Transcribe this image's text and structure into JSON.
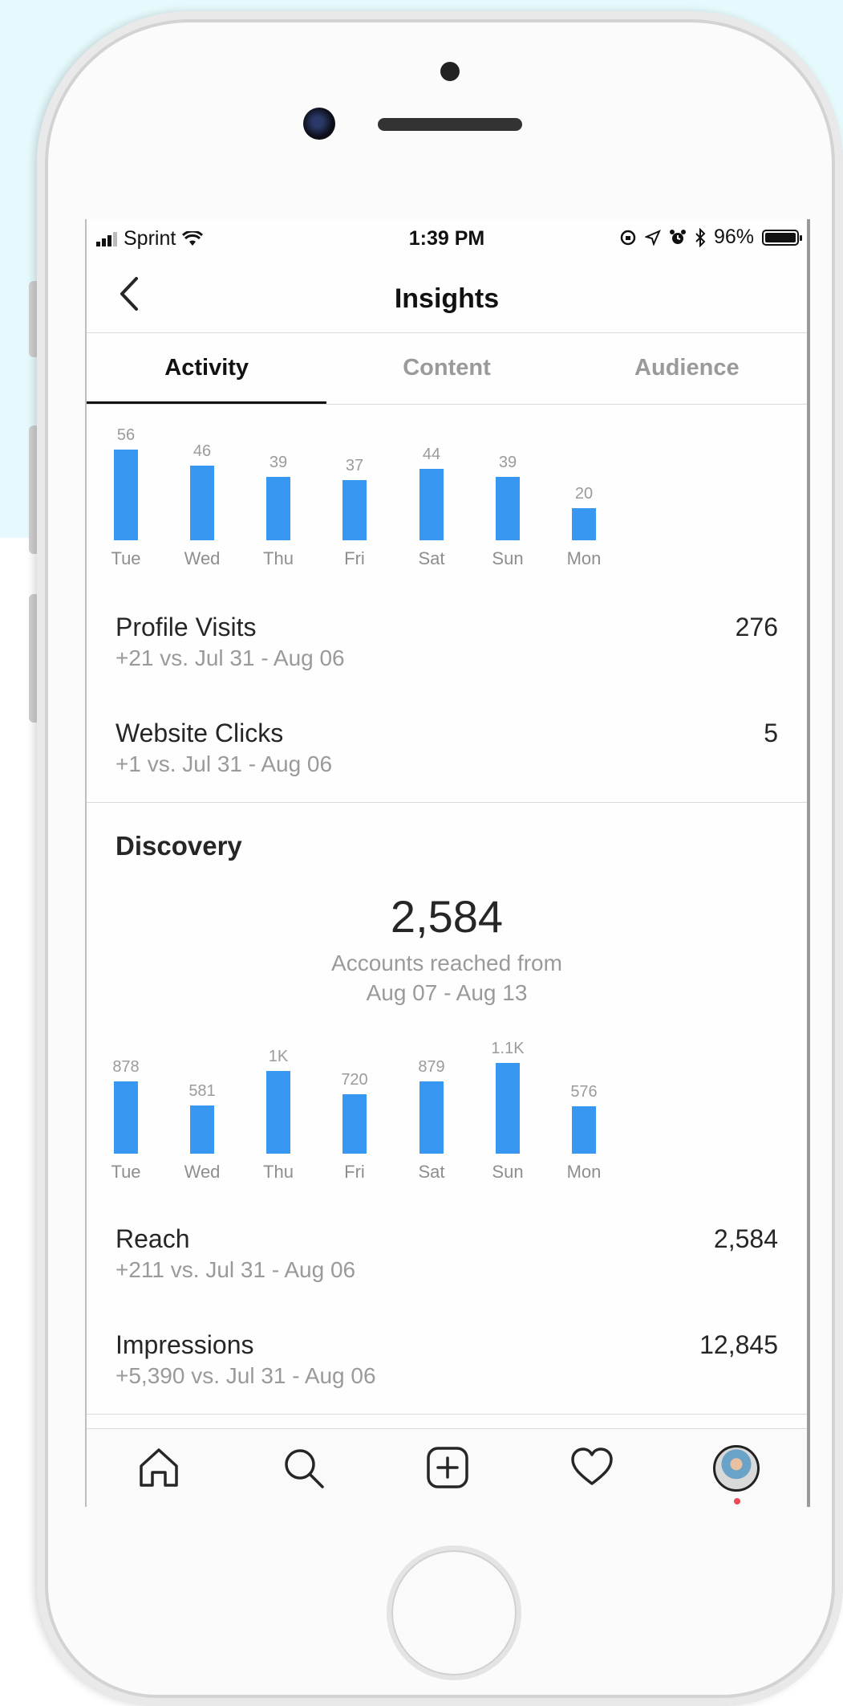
{
  "status_bar": {
    "carrier": "Sprint",
    "time": "1:39 PM",
    "battery": "96%"
  },
  "nav": {
    "title": "Insights"
  },
  "tabs": [
    {
      "label": "Activity",
      "active": true
    },
    {
      "label": "Content",
      "active": false
    },
    {
      "label": "Audience",
      "active": false
    }
  ],
  "activity": {
    "chart": {
      "type": "bar",
      "categories": [
        "Tue",
        "Wed",
        "Thu",
        "Fri",
        "Sat",
        "Sun",
        "Mon"
      ],
      "values": [
        56,
        46,
        39,
        37,
        44,
        39,
        20
      ],
      "value_labels": [
        "56",
        "46",
        "39",
        "37",
        "44",
        "39",
        "20"
      ],
      "bar_color": "#3897f0"
    },
    "profile_visits": {
      "label": "Profile Visits",
      "value": "276",
      "comparison": "+21 vs. Jul 31 - Aug 06"
    },
    "website_clicks": {
      "label": "Website Clicks",
      "value": "5",
      "comparison": "+1 vs. Jul 31 - Aug 06"
    }
  },
  "discovery": {
    "title": "Discovery",
    "accounts_reached": "2,584",
    "caption_line1": "Accounts reached from",
    "caption_line2": "Aug 07 - Aug 13",
    "chart": {
      "type": "bar",
      "categories": [
        "Tue",
        "Wed",
        "Thu",
        "Fri",
        "Sat",
        "Sun",
        "Mon"
      ],
      "values": [
        878,
        581,
        1000,
        720,
        879,
        1100,
        576
      ],
      "value_labels": [
        "878",
        "581",
        "1K",
        "720",
        "879",
        "1.1K",
        "576"
      ],
      "bar_color": "#3897f0"
    },
    "reach": {
      "label": "Reach",
      "value": "2,584",
      "comparison": "+211 vs. Jul 31 - Aug 06"
    },
    "impressions": {
      "label": "Impressions",
      "value": "12,845",
      "comparison": "+5,390 vs. Jul 31 - Aug 06"
    }
  },
  "chart_data": [
    {
      "type": "bar",
      "categories": [
        "Tue",
        "Wed",
        "Thu",
        "Fri",
        "Sat",
        "Sun",
        "Mon"
      ],
      "values": [
        56,
        46,
        39,
        37,
        44,
        39,
        20
      ]
    },
    {
      "type": "bar",
      "categories": [
        "Tue",
        "Wed",
        "Thu",
        "Fri",
        "Sat",
        "Sun",
        "Mon"
      ],
      "values": [
        878,
        581,
        1000,
        720,
        879,
        1100,
        576
      ]
    }
  ],
  "tab_bar": {
    "icons": [
      "home-icon",
      "search-icon",
      "new-post-icon",
      "activity-heart-icon",
      "profile-avatar"
    ]
  }
}
